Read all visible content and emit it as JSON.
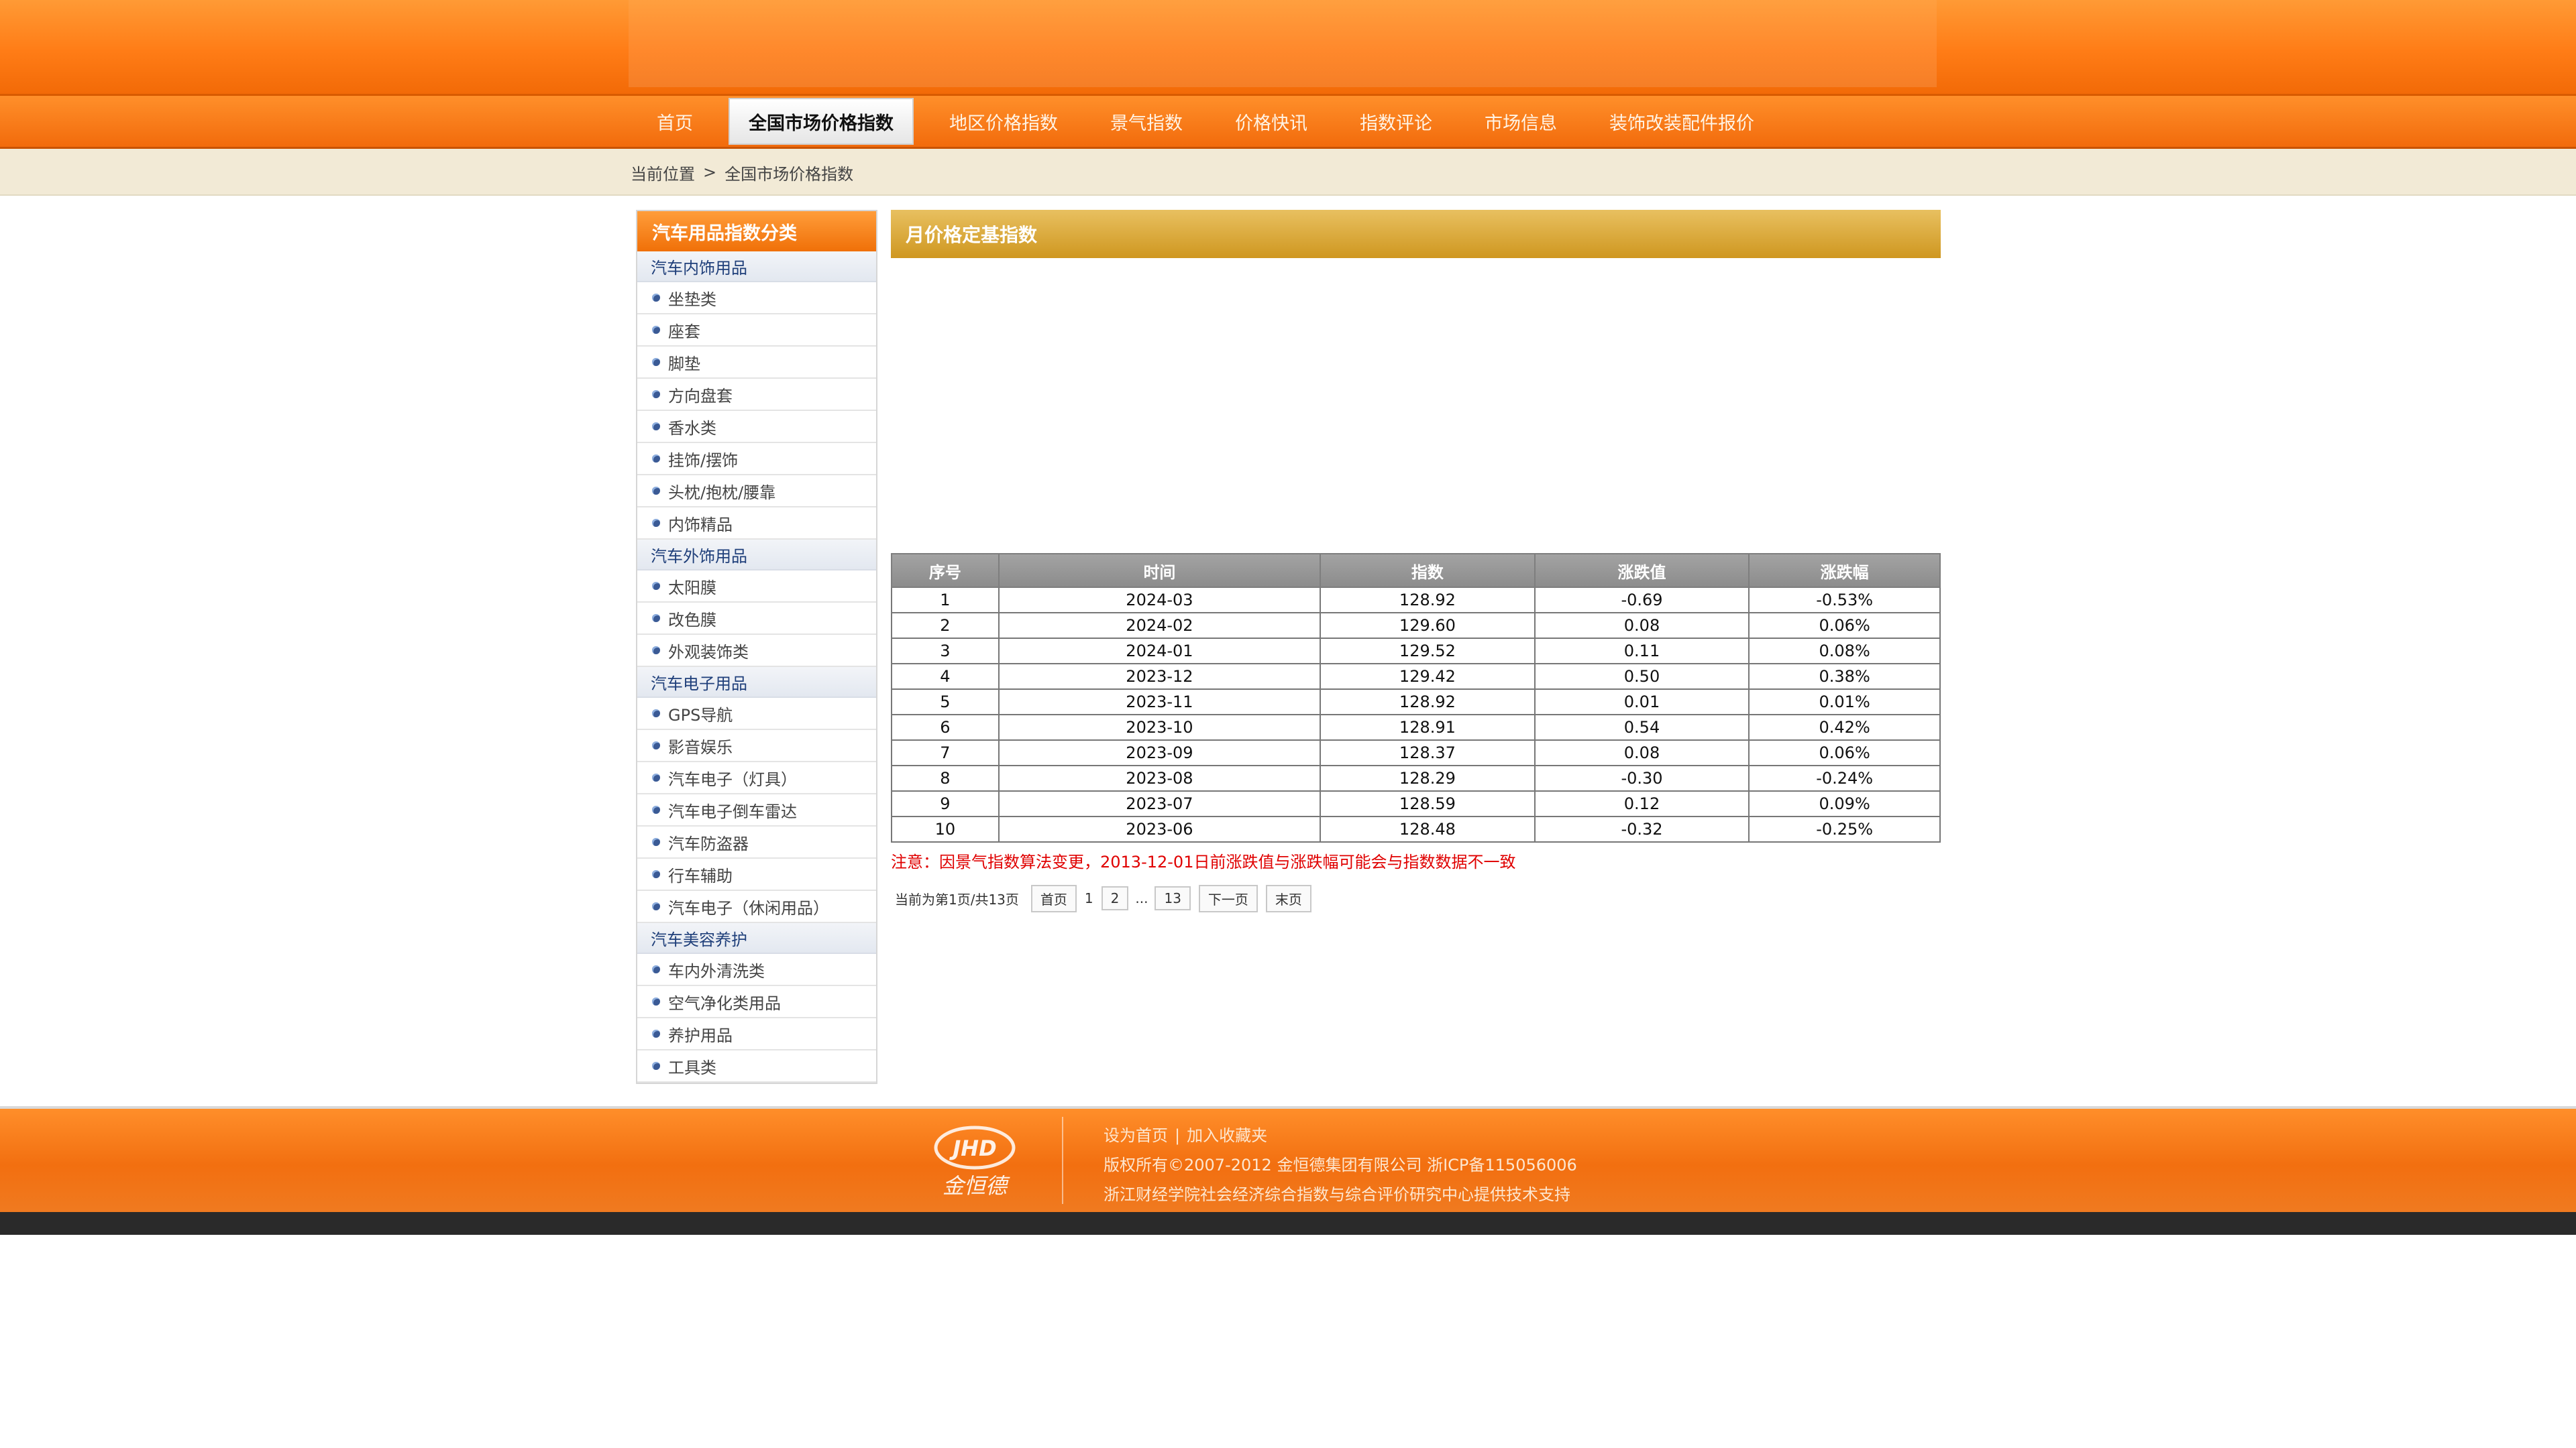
{
  "nav": {
    "items": [
      {
        "label": "首页",
        "active": false
      },
      {
        "label": "全国市场价格指数",
        "active": true
      },
      {
        "label": "地区价格指数",
        "active": false
      },
      {
        "label": "景气指数",
        "active": false
      },
      {
        "label": "价格快讯",
        "active": false
      },
      {
        "label": "指数评论",
        "active": false
      },
      {
        "label": "市场信息",
        "active": false
      },
      {
        "label": "装饰改装配件报价",
        "active": false
      }
    ]
  },
  "breadcrumb": {
    "prefix": "当前位置",
    "separator": ">",
    "current": "全国市场价格指数"
  },
  "sidebar": {
    "title": "汽车用品指数分类",
    "groups": [
      {
        "title": "汽车内饰用品",
        "items": [
          "坐垫类",
          "座套",
          "脚垫",
          "方向盘套",
          "香水类",
          "挂饰/摆饰",
          "头枕/抱枕/腰靠",
          "内饰精品"
        ]
      },
      {
        "title": "汽车外饰用品",
        "items": [
          "太阳膜",
          "改色膜",
          "外观装饰类"
        ]
      },
      {
        "title": "汽车电子用品",
        "items": [
          "GPS导航",
          "影音娱乐",
          "汽车电子（灯具）",
          "汽车电子倒车雷达",
          "汽车防盗器",
          "行车辅助",
          "汽车电子（休闲用品）"
        ]
      },
      {
        "title": "汽车美容养护",
        "items": [
          "车内外清洗类",
          "空气净化类用品",
          "养护用品",
          "工具类"
        ]
      }
    ]
  },
  "main": {
    "title": "月价格定基指数",
    "table": {
      "headers": [
        "序号",
        "时间",
        "指数",
        "涨跌值",
        "涨跌幅"
      ],
      "rows": [
        [
          "1",
          "2024-03",
          "128.92",
          "-0.69",
          "-0.53%"
        ],
        [
          "2",
          "2024-02",
          "129.60",
          "0.08",
          "0.06%"
        ],
        [
          "3",
          "2024-01",
          "129.52",
          "0.11",
          "0.08%"
        ],
        [
          "4",
          "2023-12",
          "129.42",
          "0.50",
          "0.38%"
        ],
        [
          "5",
          "2023-11",
          "128.92",
          "0.01",
          "0.01%"
        ],
        [
          "6",
          "2023-10",
          "128.91",
          "0.54",
          "0.42%"
        ],
        [
          "7",
          "2023-09",
          "128.37",
          "0.08",
          "0.06%"
        ],
        [
          "8",
          "2023-08",
          "128.29",
          "-0.30",
          "-0.24%"
        ],
        [
          "9",
          "2023-07",
          "128.59",
          "0.12",
          "0.09%"
        ],
        [
          "10",
          "2023-06",
          "128.48",
          "-0.32",
          "-0.25%"
        ]
      ]
    },
    "notice": "注意：因景气指数算法变更，2013-12-01日前涨跌值与涨跌幅可能会与指数数据不一致",
    "pager": {
      "info": "当前为第1页/共13页",
      "first": "首页",
      "current": "1",
      "page2": "2",
      "ellipsis": "...",
      "last_num": "13",
      "next": "下一页",
      "last": "末页"
    }
  },
  "footer": {
    "logo_text": "JHD",
    "logo_cn": "金恒德",
    "link_home": "设为首页",
    "link_sep": "|",
    "link_fav": "加入收藏夹",
    "copyright": "版权所有©2007-2012 金恒德集团有限公司 浙ICP备115056006",
    "support": "浙江财经学院社会经济综合指数与综合评价研究中心提供技术支持"
  },
  "colors": {
    "brand_orange": "#f26b0c",
    "notice_red": "#e00000",
    "title_gold": "#cf9720",
    "group_blue": "#1f3f7a"
  }
}
